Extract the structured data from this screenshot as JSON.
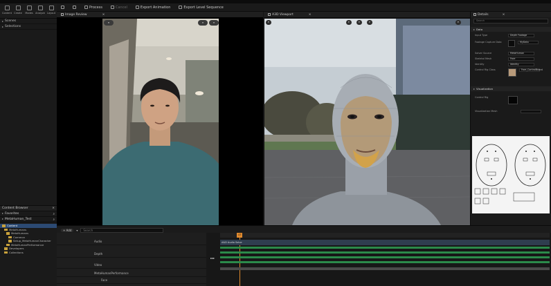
{
  "left_top": {
    "tools": [
      "Content",
      "Create",
      "Modes",
      "Analyze",
      "Layout"
    ]
  },
  "toolbar": {
    "process": "Process",
    "cancel": "Cancel",
    "export_animation": "Export Animation",
    "export_level_sequence": "Export Level Sequence"
  },
  "left_panel": {
    "items": [
      "Scenes",
      "Selections"
    ]
  },
  "content_browser": {
    "title": "Content Browser",
    "favorites": "Favorites",
    "project": "MetaHuman_Test",
    "tree": [
      "Content",
      "MetaHumans",
      "MetaHumans",
      "Common",
      "Setup_MetaHumanCharacter",
      "MetaHumanPerformance",
      "Developers",
      "Collections"
    ]
  },
  "image_review": {
    "tab": "Image Review"
  },
  "viewport": {
    "tab": "A3D Viewport"
  },
  "details": {
    "tab": "Details",
    "search_placeholder": "Search",
    "sections": [
      "Data",
      "Visualization"
    ],
    "rows": [
      {
        "label": "Input Type",
        "value": "Depth Footage"
      },
      {
        "label": "Footage Capture Data",
        "value": "MyData"
      },
      {
        "label": "Solver Source",
        "value": "MetaHuman"
      },
      {
        "label": "Skeletal Mesh",
        "value": "Face"
      },
      {
        "label": "Identity",
        "value": "Identity"
      },
      {
        "label": "Control Rig Class",
        "value": "Face_ControlBoard"
      }
    ],
    "viz_rows": [
      "Control Rig",
      "Visualization Mesh"
    ]
  },
  "sequencer": {
    "add_label": "+ Add",
    "search_placeholder": "Search",
    "tracks": [
      "Audio",
      "Depth",
      "Video",
      "MetaHumanPerformance",
      "Face"
    ],
    "frame_marker": "47",
    "clip_label": "A&D Audio Solve"
  },
  "colors": {
    "accent": "#2c4a73",
    "sequencer_green": "#2b8a4a",
    "playhead": "#e08a2e",
    "folder": "#c9a23c"
  }
}
